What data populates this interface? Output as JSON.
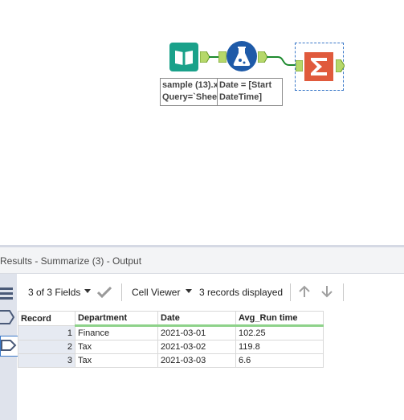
{
  "canvas": {
    "input_tool": {
      "icon": "input-book-icon",
      "color": "#1aa18a"
    },
    "formula_tool": {
      "icon": "formula-flask-icon",
      "color": "#1e5aa8"
    },
    "summarize_tool": {
      "icon": "summarize-sigma-icon",
      "color": "#e05a3c"
    },
    "annotations": {
      "input_line1": "sample (13).x",
      "input_line2": "Query=`Sheet",
      "formula_line1": "Date = [Start",
      "formula_line2": "DateTime]"
    }
  },
  "results": {
    "title": "Results - Summarize (3) - Output",
    "toolbar": {
      "fields_label": "3 of 3 Fields",
      "viewer_label": "Cell Viewer",
      "records_label": "3 records displayed"
    },
    "columns": [
      "Record",
      "Department",
      "Date",
      "Avg_Run time"
    ],
    "rows": [
      {
        "record": "1",
        "department": "Finance",
        "date": "2021-03-01",
        "avg": "102.25"
      },
      {
        "record": "2",
        "department": "Tax",
        "date": "2021-03-02",
        "avg": "119.8"
      },
      {
        "record": "3",
        "department": "Tax",
        "date": "2021-03-03",
        "avg": "6.6"
      }
    ]
  },
  "colors": {
    "accent_green": "#8ed28a",
    "connector_green": "#1d8a2e"
  }
}
